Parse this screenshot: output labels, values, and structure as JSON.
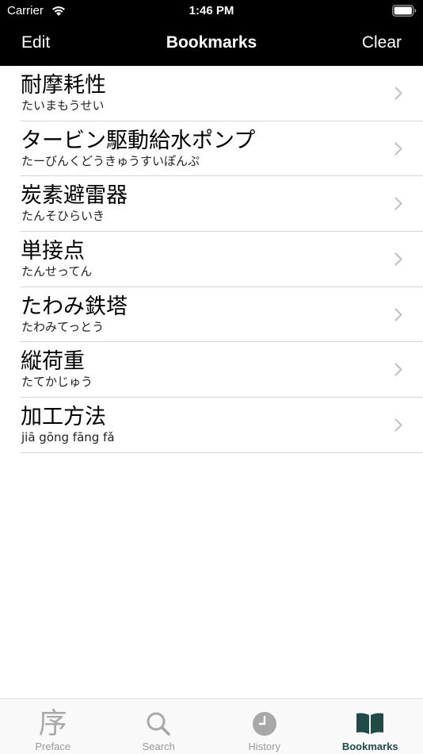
{
  "status_bar": {
    "carrier": "Carrier",
    "time": "1:46 PM",
    "wifi_icon": "wifi-icon",
    "battery_icon": "battery-icon"
  },
  "nav": {
    "edit_label": "Edit",
    "title": "Bookmarks",
    "clear_label": "Clear"
  },
  "bookmarks": [
    {
      "term": "耐摩耗性",
      "reading": "たいまもうせい"
    },
    {
      "term": "タービン駆動給水ポンプ",
      "reading": "たーびんくどうきゅうすいぽんぷ"
    },
    {
      "term": "炭素避雷器",
      "reading": "たんそひらいき"
    },
    {
      "term": "単接点",
      "reading": "たんせってん"
    },
    {
      "term": "たわみ鉄塔",
      "reading": "たわみてっとう"
    },
    {
      "term": "縦荷重",
      "reading": "たてかじゅう"
    },
    {
      "term": "加工方法",
      "reading": "jiā gōng fāng fǎ"
    }
  ],
  "tabbar": {
    "tabs": [
      {
        "label": "Preface",
        "icon": "preface-kanji-icon",
        "glyph": "序",
        "active": false
      },
      {
        "label": "Search",
        "icon": "magnifier-icon",
        "active": false
      },
      {
        "label": "History",
        "icon": "clock-icon",
        "active": false
      },
      {
        "label": "Bookmarks",
        "icon": "book-icon",
        "active": true
      }
    ]
  },
  "colors": {
    "header_bg": "#000000",
    "active_tab": "#1f4a48",
    "inactive_tab": "#9a9a9a",
    "separator": "#d4d4d8"
  }
}
